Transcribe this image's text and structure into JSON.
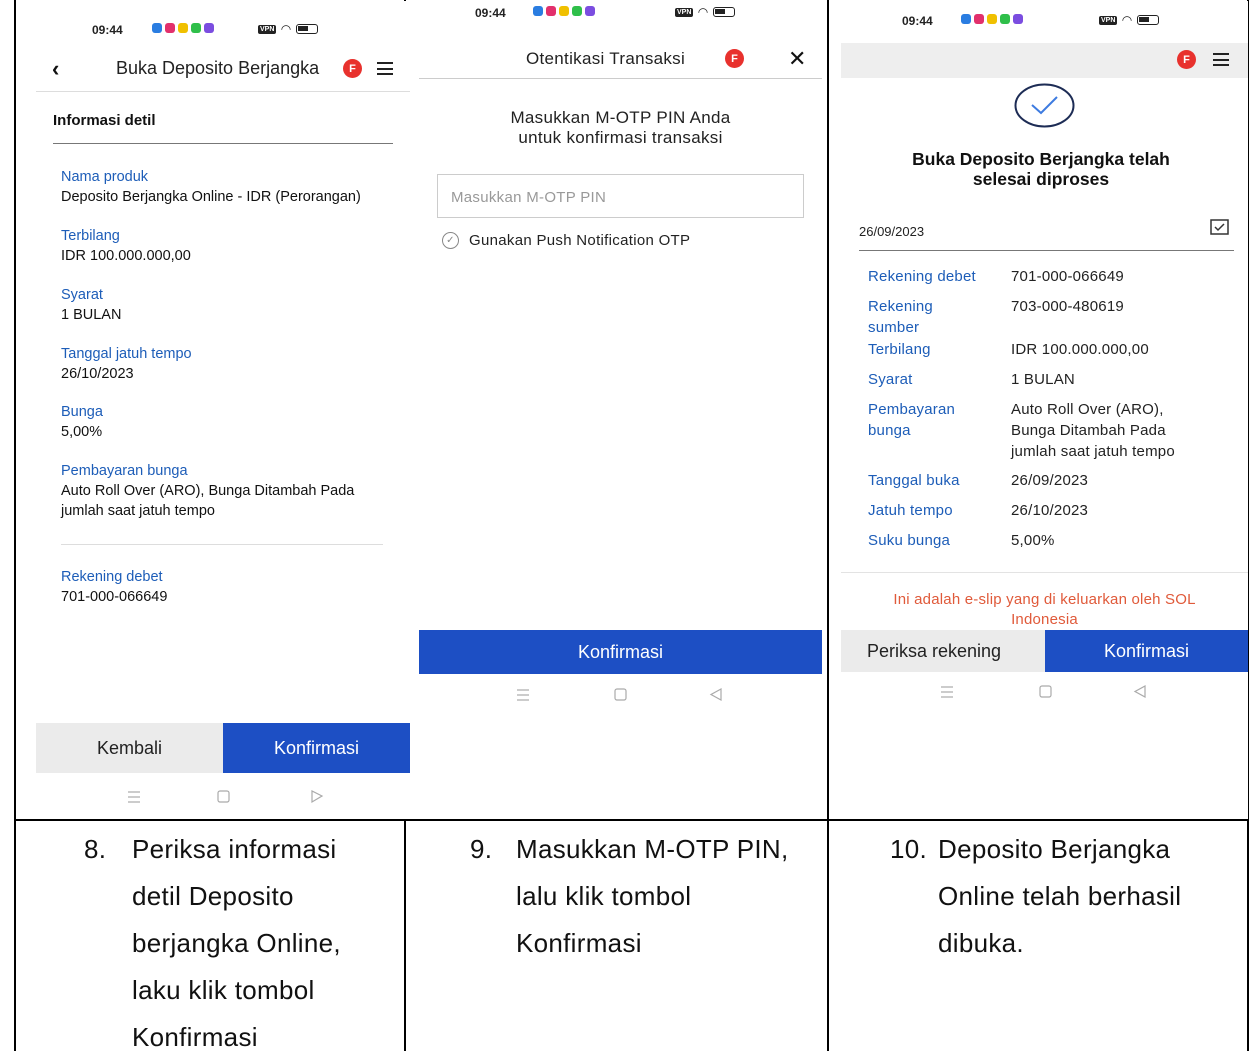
{
  "status_bar": {
    "time": "09:44",
    "vpn": "VPN"
  },
  "panel1": {
    "header_title": "Buka Deposito Berjangka",
    "badge": "F",
    "section_title": "Informasi detil",
    "fields": [
      {
        "label": "Nama produk",
        "value": "Deposito Berjangka Online - IDR (Perorangan)"
      },
      {
        "label": "Terbilang",
        "value": "IDR 100.000.000,00"
      },
      {
        "label": "Syarat",
        "value": "1 BULAN"
      },
      {
        "label": "Tanggal jatuh tempo",
        "value": "26/10/2023"
      },
      {
        "label": "Bunga",
        "value": "5,00%"
      },
      {
        "label": "Pembayaran bunga",
        "value": "Auto Roll Over (ARO), Bunga Ditambah Pada jumlah saat jatuh tempo"
      },
      {
        "label": "Rekening debet",
        "value": "701-000-066649"
      }
    ],
    "back_button": "Kembali",
    "confirm_button": "Konfirmasi"
  },
  "panel2": {
    "header_title": "Otentikasi Transaksi",
    "badge": "F",
    "prompt_line1": "Masukkan M-OTP PIN Anda",
    "prompt_line2": "untuk konfirmasi transaksi",
    "otp_placeholder": "Masukkan M-OTP PIN",
    "push_option": "Gunakan Push Notification OTP",
    "confirm_button": "Konfirmasi"
  },
  "panel3": {
    "badge": "F",
    "success_line1": "Buka Deposito Berjangka telah",
    "success_line2": "selesai diproses",
    "date": "26/09/2023",
    "rows": [
      {
        "key": "Rekening debet",
        "value": "701-000-066649"
      },
      {
        "key": "Rekening sumber",
        "value": "703-000-480619"
      },
      {
        "key": "Terbilang",
        "value": "IDR 100.000.000,00"
      },
      {
        "key": "Syarat",
        "value": "1 BULAN"
      },
      {
        "key": "Pembayaran bunga",
        "value": "Auto Roll Over (ARO), Bunga Ditambah Pada jumlah saat jatuh tempo"
      },
      {
        "key": "Tanggal buka",
        "value": "26/09/2023"
      },
      {
        "key": "Jatuh tempo",
        "value": "26/10/2023"
      },
      {
        "key": "Suku bunga",
        "value": "5,00%"
      }
    ],
    "eslip_line1": "Ini adalah e-slip yang di keluarkan oleh SOL",
    "eslip_line2": "Indonesia",
    "check_account_button": "Periksa rekening",
    "confirm_button": "Konfirmasi"
  },
  "captions": [
    {
      "number": "8.",
      "lines": [
        "Periksa informasi",
        "detil Deposito",
        "berjangka Online,",
        "laku klik tombol",
        "Konfirmasi"
      ]
    },
    {
      "number": "9.",
      "lines": [
        "Masukkan M-OTP PIN,",
        "lalu klik tombol",
        "Konfirmasi"
      ]
    },
    {
      "number": "10.",
      "lines": [
        "Deposito Berjangka",
        "Online telah berhasil",
        "dibuka."
      ]
    }
  ],
  "colors": {
    "accent_blue": "#1d4fc4",
    "label_blue": "#1d5db8",
    "badge_red": "#e8312d",
    "eslip_red": "#e05a3a"
  }
}
